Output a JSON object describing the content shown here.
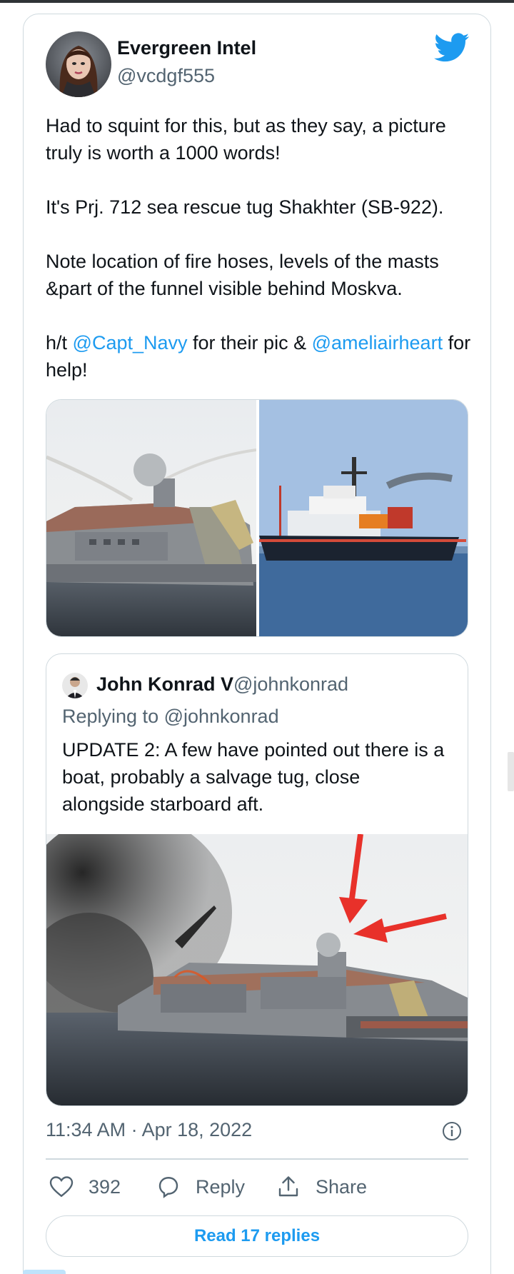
{
  "author": {
    "name": "Evergreen Intel",
    "handle": "@vcdgf555"
  },
  "tweet": {
    "line1": "Had to squint for this, but as they say, a picture truly is worth a 1000 words!",
    "line2": "It's Prj. 712 sea rescue tug Shakhter (SB-922).",
    "line3": "Note location of fire hoses, levels of the masts &part of the funnel visible behind Moskva.",
    "line4_prefix": "h/t ",
    "line4_link1": "@Capt_Navy",
    "line4_middle": " for their pic & ",
    "line4_link2": "@ameliairheart",
    "line4_suffix": " for help!"
  },
  "quoted": {
    "name": "John Konrad V",
    "handle": "@johnkonrad",
    "replying": "Replying to @johnkonrad",
    "text": "UPDATE 2: A few have pointed out there is a boat, probably a salvage tug, close alongside starboard aft."
  },
  "meta": {
    "timestamp": "11:34 AM · Apr 18, 2022"
  },
  "actions": {
    "like_count": "392",
    "reply_label": "Reply",
    "share_label": "Share",
    "read_replies": "Read 17 replies"
  },
  "colors": {
    "link": "#1d9bf0",
    "twitter_blue": "#1d9bf0",
    "secondary_text": "#536471",
    "border": "#cfd9de"
  },
  "icons": [
    "twitter-bird-icon",
    "info-icon",
    "heart-icon",
    "reply-bubble-icon",
    "share-icon"
  ]
}
